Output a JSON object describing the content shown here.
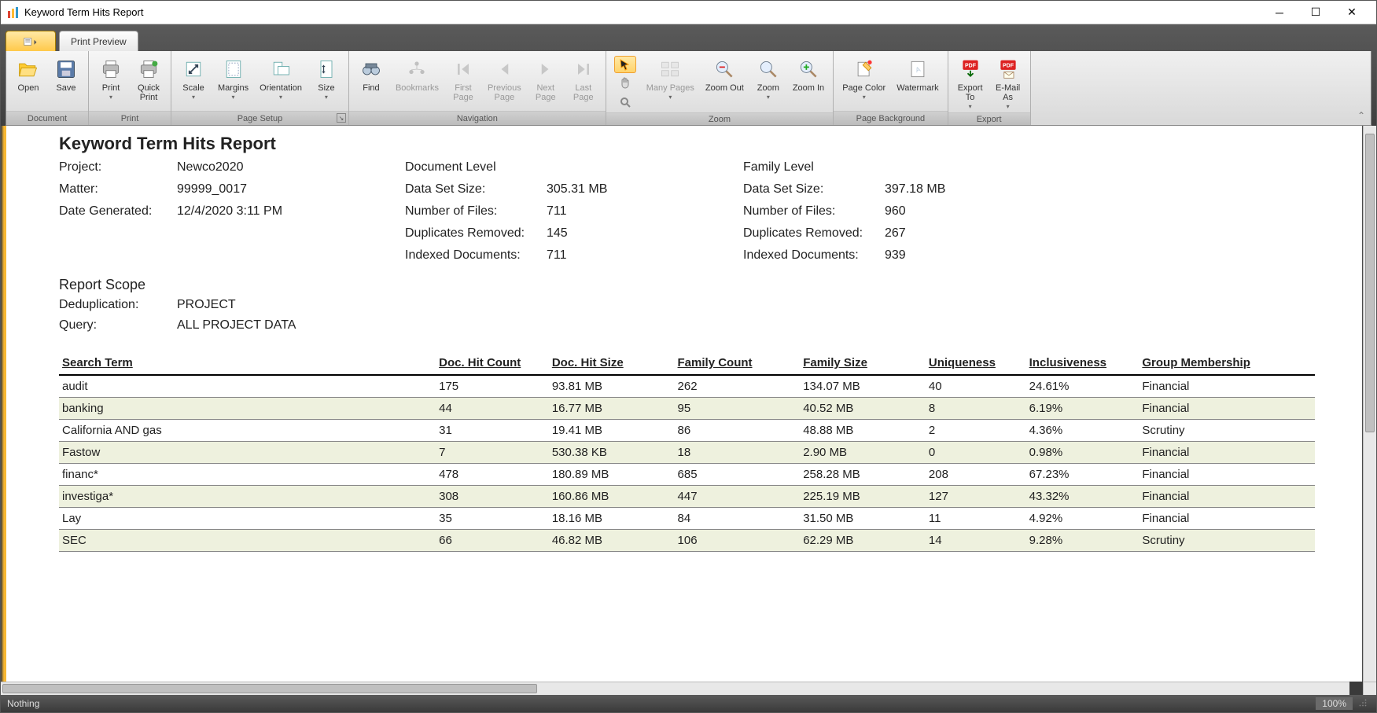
{
  "window": {
    "title": "Keyword Term Hits Report"
  },
  "tabs": {
    "print_preview": "Print Preview"
  },
  "ribbon": {
    "groups": {
      "document": {
        "label": "Document",
        "open": "Open",
        "save": "Save"
      },
      "print": {
        "label": "Print",
        "print": "Print",
        "quick_print": "Quick\nPrint"
      },
      "page_setup": {
        "label": "Page Setup",
        "scale": "Scale",
        "margins": "Margins",
        "orientation": "Orientation",
        "size": "Size"
      },
      "navigation": {
        "label": "Navigation",
        "find": "Find",
        "bookmarks": "Bookmarks",
        "first_page": "First\nPage",
        "previous_page": "Previous\nPage",
        "next_page": "Next\nPage",
        "last_page": "Last\nPage"
      },
      "zoom": {
        "label": "Zoom",
        "many_pages": "Many Pages",
        "zoom_out": "Zoom Out",
        "zoom": "Zoom",
        "zoom_in": "Zoom In"
      },
      "page_background": {
        "label": "Page Background",
        "page_color": "Page Color",
        "watermark": "Watermark"
      },
      "export": {
        "label": "Export",
        "export_to": "Export\nTo",
        "email_as": "E-Mail\nAs"
      }
    }
  },
  "report": {
    "title": "Keyword Term Hits Report",
    "project_lbl": "Project:",
    "project": "Newco2020",
    "matter_lbl": "Matter:",
    "matter": "99999_0017",
    "date_lbl": "Date Generated:",
    "date": "12/4/2020 3:11 PM",
    "doc_level_hdr": "Document Level",
    "fam_level_hdr": "Family Level",
    "data_set_size_lbl": "Data Set Size:",
    "num_files_lbl": "Number of Files:",
    "dup_removed_lbl": "Duplicates Removed:",
    "indexed_lbl": "Indexed Documents:",
    "doc_level": {
      "data_set_size": "305.31 MB",
      "num_files": "711",
      "dup_removed": "145",
      "indexed": "711"
    },
    "fam_level": {
      "data_set_size": "397.18 MB",
      "num_files": "960",
      "dup_removed": "267",
      "indexed": "939"
    },
    "scope_title": "Report Scope",
    "dedup_lbl": "Deduplication:",
    "dedup": "PROJECT",
    "query_lbl": "Query:",
    "query": "ALL PROJECT DATA",
    "columns": {
      "term": "Search Term",
      "doc_hit_count": "Doc. Hit Count",
      "doc_hit_size": "Doc. Hit Size",
      "family_count": "Family Count",
      "family_size": "Family Size",
      "uniqueness": "Uniqueness",
      "inclusiveness": "Inclusiveness",
      "group": "Group Membership"
    },
    "rows": [
      {
        "term": "audit",
        "dhc": "175",
        "dhs": "93.81 MB",
        "fc": "262",
        "fs": "134.07 MB",
        "uniq": "40",
        "incl": "24.61%",
        "grp": "Financial"
      },
      {
        "term": "banking",
        "dhc": "44",
        "dhs": "16.77 MB",
        "fc": "95",
        "fs": "40.52 MB",
        "uniq": "8",
        "incl": "6.19%",
        "grp": "Financial"
      },
      {
        "term": "California AND gas",
        "dhc": "31",
        "dhs": "19.41 MB",
        "fc": "86",
        "fs": "48.88 MB",
        "uniq": "2",
        "incl": "4.36%",
        "grp": "Scrutiny"
      },
      {
        "term": "Fastow",
        "dhc": "7",
        "dhs": "530.38 KB",
        "fc": "18",
        "fs": "2.90 MB",
        "uniq": "0",
        "incl": "0.98%",
        "grp": "Financial"
      },
      {
        "term": "financ*",
        "dhc": "478",
        "dhs": "180.89 MB",
        "fc": "685",
        "fs": "258.28 MB",
        "uniq": "208",
        "incl": "67.23%",
        "grp": "Financial"
      },
      {
        "term": "investiga*",
        "dhc": "308",
        "dhs": "160.86 MB",
        "fc": "447",
        "fs": "225.19 MB",
        "uniq": "127",
        "incl": "43.32%",
        "grp": "Financial"
      },
      {
        "term": "Lay",
        "dhc": "35",
        "dhs": "18.16 MB",
        "fc": "84",
        "fs": "31.50 MB",
        "uniq": "11",
        "incl": "4.92%",
        "grp": "Financial"
      },
      {
        "term": "SEC",
        "dhc": "66",
        "dhs": "46.82 MB",
        "fc": "106",
        "fs": "62.29 MB",
        "uniq": "14",
        "incl": "9.28%",
        "grp": "Scrutiny"
      }
    ]
  },
  "statusbar": {
    "left": "Nothing",
    "zoom": "100%"
  }
}
